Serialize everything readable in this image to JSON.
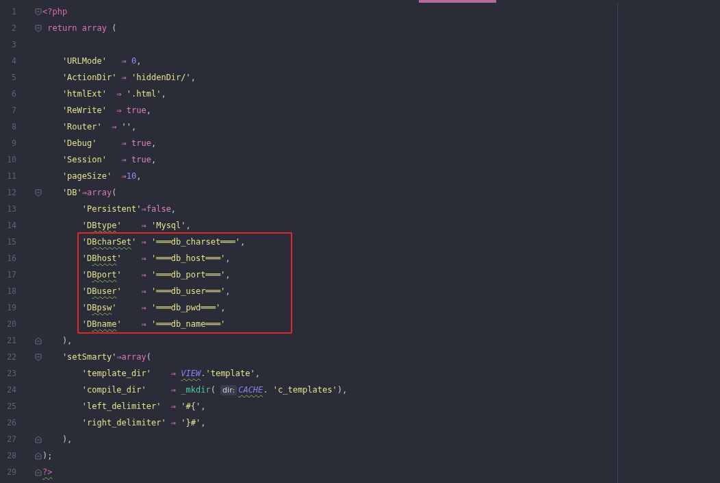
{
  "editor": {
    "blocks": [
      {
        "kind": "plain",
        "lines": [
          {
            "number": "1",
            "fold_start": true,
            "tokens": [
              {
                "kind": "tag",
                "text": "<?php"
              }
            ]
          },
          {
            "number": "2",
            "fold_start": true,
            "tokens": [
              {
                "kind": "keyword",
                "text": " return array "
              },
              {
                "kind": "punct",
                "text": "("
              }
            ]
          },
          {
            "number": "3"
          },
          {
            "number": "4",
            "tokens": [
              {
                "kind": "string",
                "text": "    'URLMode'"
              },
              {
                "kind": "operator",
                "text": "   ⇒ "
              },
              {
                "kind": "number",
                "text": "0"
              },
              {
                "kind": "punct",
                "text": ","
              }
            ]
          },
          {
            "number": "5",
            "tokens": [
              {
                "kind": "string",
                "text": "    'ActionDir'"
              },
              {
                "kind": "operator",
                "text": " ⇒ "
              },
              {
                "kind": "string",
                "text": "'hiddenDir/'"
              },
              {
                "kind": "punct",
                "text": ","
              }
            ]
          },
          {
            "number": "6",
            "tokens": [
              {
                "kind": "string",
                "text": "    'htmlExt'"
              },
              {
                "kind": "operator",
                "text": "  ⇒ "
              },
              {
                "kind": "string",
                "text": "'.html'"
              },
              {
                "kind": "punct",
                "text": ","
              }
            ]
          },
          {
            "number": "7",
            "tokens": [
              {
                "kind": "string",
                "text": "    'ReWrite'"
              },
              {
                "kind": "operator",
                "text": "  ⇒ "
              },
              {
                "kind": "bool",
                "text": "true"
              },
              {
                "kind": "punct",
                "text": ","
              }
            ]
          },
          {
            "number": "8",
            "tokens": [
              {
                "kind": "string",
                "text": "    'Router'"
              },
              {
                "kind": "operator",
                "text": "  ⇒ "
              },
              {
                "kind": "string",
                "text": "''"
              },
              {
                "kind": "punct",
                "text": ","
              }
            ]
          },
          {
            "number": "9",
            "tokens": [
              {
                "kind": "string",
                "text": "    'Debug'"
              },
              {
                "kind": "operator",
                "text": "     ⇒ "
              },
              {
                "kind": "bool",
                "text": "true"
              },
              {
                "kind": "punct",
                "text": ","
              }
            ]
          },
          {
            "number": "10",
            "tokens": [
              {
                "kind": "string",
                "text": "    'Session'"
              },
              {
                "kind": "operator",
                "text": "   ⇒ "
              },
              {
                "kind": "bool",
                "text": "true"
              },
              {
                "kind": "punct",
                "text": ","
              }
            ]
          },
          {
            "number": "11",
            "tokens": [
              {
                "kind": "string",
                "text": "    'pageSize'"
              },
              {
                "kind": "operator",
                "text": "  ⇒"
              },
              {
                "kind": "number",
                "text": "10"
              },
              {
                "kind": "punct",
                "text": ","
              }
            ]
          },
          {
            "number": "12",
            "fold_start": true,
            "tokens": [
              {
                "kind": "string",
                "text": "    'DB'"
              },
              {
                "kind": "operator",
                "text": "⇒"
              },
              {
                "kind": "keyword",
                "text": "array"
              },
              {
                "kind": "punct",
                "text": "("
              }
            ]
          },
          {
            "number": "13",
            "tokens": [
              {
                "kind": "string",
                "text": "        'Persistent'"
              },
              {
                "kind": "operator",
                "text": "⇒"
              },
              {
                "kind": "bool",
                "text": "false"
              },
              {
                "kind": "punct",
                "text": ","
              }
            ]
          },
          {
            "number": "14",
            "tokens": [
              {
                "kind": "string",
                "text": "        'D"
              },
              {
                "kind": "string",
                "text": "Btype",
                "warning": true
              },
              {
                "kind": "string",
                "text": "'"
              },
              {
                "kind": "operator",
                "text": "    ⇒ "
              },
              {
                "kind": "string",
                "text": "'Mysql'"
              },
              {
                "kind": "punct",
                "text": ","
              }
            ]
          }
        ]
      },
      {
        "kind": "highlighted",
        "lines": [
          {
            "number": "15",
            "tokens": [
              {
                "kind": "string",
                "text": "        'D"
              },
              {
                "kind": "string",
                "text": "BcharSet",
                "warning": true
              },
              {
                "kind": "string",
                "text": "'"
              },
              {
                "kind": "operator",
                "text": " ⇒ "
              },
              {
                "kind": "string",
                "text": "'═══db_charset═══'"
              },
              {
                "kind": "punct",
                "text": ","
              }
            ]
          },
          {
            "number": "16",
            "tokens": [
              {
                "kind": "string",
                "text": "        'D"
              },
              {
                "kind": "string",
                "text": "Bhost",
                "warning": true
              },
              {
                "kind": "string",
                "text": "'"
              },
              {
                "kind": "operator",
                "text": "    ⇒ "
              },
              {
                "kind": "string",
                "text": "'═══db_host═══'"
              },
              {
                "kind": "punct",
                "text": ","
              }
            ]
          },
          {
            "number": "17",
            "tokens": [
              {
                "kind": "string",
                "text": "        'D"
              },
              {
                "kind": "string",
                "text": "Bport",
                "warning": true
              },
              {
                "kind": "string",
                "text": "'"
              },
              {
                "kind": "operator",
                "text": "    ⇒ "
              },
              {
                "kind": "string",
                "text": "'═══db_port═══'"
              },
              {
                "kind": "punct",
                "text": ","
              }
            ]
          },
          {
            "number": "18",
            "tokens": [
              {
                "kind": "string",
                "text": "        'D"
              },
              {
                "kind": "string",
                "text": "Buser",
                "warning": true
              },
              {
                "kind": "string",
                "text": "'"
              },
              {
                "kind": "operator",
                "text": "    ⇒ "
              },
              {
                "kind": "string",
                "text": "'═══db_user═══'"
              },
              {
                "kind": "punct",
                "text": ","
              }
            ]
          },
          {
            "number": "19",
            "tokens": [
              {
                "kind": "string",
                "text": "        'D"
              },
              {
                "kind": "string",
                "text": "Bpsw",
                "warning": true
              },
              {
                "kind": "string",
                "text": "'"
              },
              {
                "kind": "operator",
                "text": "     ⇒ "
              },
              {
                "kind": "string",
                "text": "'═══db_pwd═══'"
              },
              {
                "kind": "punct",
                "text": ","
              }
            ]
          },
          {
            "number": "20",
            "tokens": [
              {
                "kind": "string",
                "text": "        'D"
              },
              {
                "kind": "string",
                "text": "Bname",
                "warning": true
              },
              {
                "kind": "string",
                "text": "'"
              },
              {
                "kind": "operator",
                "text": "    ⇒ "
              },
              {
                "kind": "string",
                "text": "'═══db_name═══'"
              }
            ]
          }
        ]
      },
      {
        "kind": "plain",
        "lines": [
          {
            "number": "21",
            "fold_end": true,
            "tokens": [
              {
                "kind": "punct",
                "text": "    ),"
              }
            ]
          },
          {
            "number": "22",
            "fold_start": true,
            "tokens": [
              {
                "kind": "string",
                "text": "    'setSmarty'"
              },
              {
                "kind": "operator",
                "text": "⇒"
              },
              {
                "kind": "keyword",
                "text": "array"
              },
              {
                "kind": "punct",
                "text": "("
              }
            ]
          },
          {
            "number": "23",
            "tokens": [
              {
                "kind": "string",
                "text": "        'template_dir'"
              },
              {
                "kind": "operator",
                "text": "    ⇒ "
              },
              {
                "kind": "constant",
                "text": "VIEW",
                "warning": true
              },
              {
                "kind": "punct",
                "text": "."
              },
              {
                "kind": "string",
                "text": "'template'"
              },
              {
                "kind": "punct",
                "text": ","
              }
            ]
          },
          {
            "number": "24",
            "tokens": [
              {
                "kind": "string",
                "text": "        'compile_dir'"
              },
              {
                "kind": "operator",
                "text": "     ⇒ "
              },
              {
                "kind": "function",
                "text": "_mkdir"
              },
              {
                "kind": "punct",
                "text": "( "
              },
              {
                "kind": "hint",
                "text": "dir:"
              },
              {
                "kind": "constant",
                "text": "CACHE",
                "warning": true
              },
              {
                "kind": "punct",
                "text": ". "
              },
              {
                "kind": "string",
                "text": "'c_templates'"
              },
              {
                "kind": "punct",
                "text": "),"
              }
            ]
          },
          {
            "number": "25",
            "tokens": [
              {
                "kind": "string",
                "text": "        'left_delimiter'"
              },
              {
                "kind": "operator",
                "text": "  ⇒ "
              },
              {
                "kind": "string",
                "text": "'#{'"
              },
              {
                "kind": "punct",
                "text": ","
              }
            ]
          },
          {
            "number": "26",
            "tokens": [
              {
                "kind": "string",
                "text": "        'right_delimiter'"
              },
              {
                "kind": "operator",
                "text": " ⇒ "
              },
              {
                "kind": "string",
                "text": "'}#'"
              },
              {
                "kind": "punct",
                "text": ","
              }
            ]
          },
          {
            "number": "27",
            "fold_end": true,
            "tokens": [
              {
                "kind": "punct",
                "text": "    ),"
              }
            ]
          },
          {
            "number": "28",
            "fold_end": true,
            "tokens": [
              {
                "kind": "punct",
                "text": ");"
              }
            ]
          },
          {
            "number": "29",
            "fold_end": true,
            "tokens": [
              {
                "kind": "tag",
                "text": "?>",
                "warning": true
              }
            ]
          }
        ]
      }
    ]
  }
}
